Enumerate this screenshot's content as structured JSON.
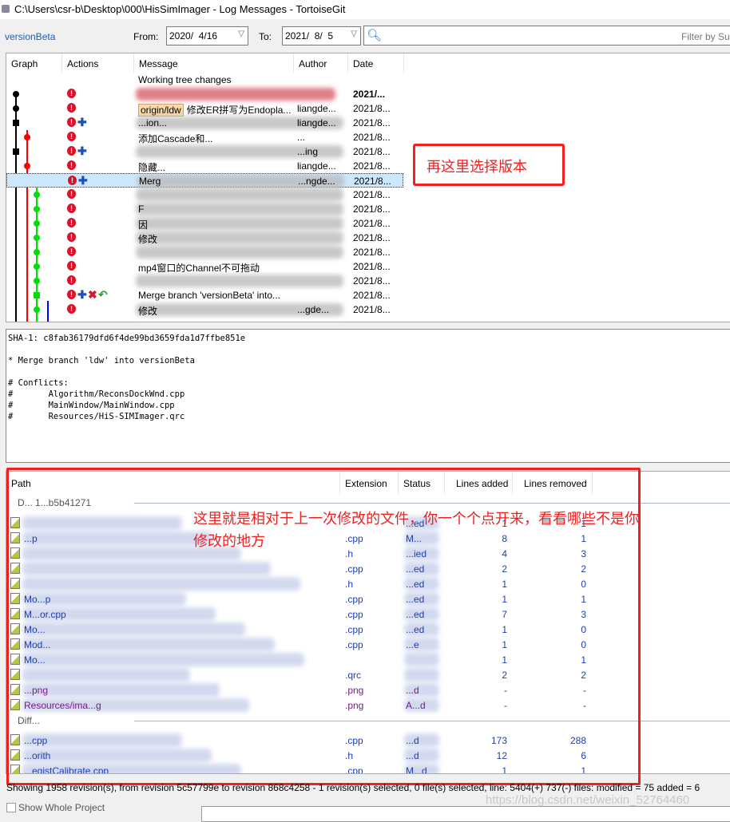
{
  "window": {
    "title": "C:\\Users\\csr-b\\Desktop\\000\\HisSimImager - Log Messages - TortoiseGit"
  },
  "toolbar": {
    "branch": "versionBeta",
    "from_label": "From:",
    "from_value": "2020/  4/16",
    "to_label": "To:",
    "to_value": "2021/  8/  5",
    "filter_placeholder": "Filter by Su"
  },
  "log": {
    "columns": [
      "Graph",
      "Actions",
      "Message",
      "Author",
      "Date"
    ],
    "rows": [
      {
        "message": "Working tree changes",
        "author": "",
        "date": "",
        "actions": []
      },
      {
        "message": "",
        "author": "",
        "date": "2021/...",
        "actions": [
          "conflict"
        ],
        "bold": true,
        "blur": "red"
      },
      {
        "badge": "origin/ldw",
        "message": "修改ER拼写为Endopla...",
        "author": "liangde...",
        "date": "2021/8...",
        "actions": [
          "conflict"
        ]
      },
      {
        "message": "...ion...",
        "author": "liangde...",
        "date": "2021/8...",
        "actions": [
          "conflict",
          "plus"
        ],
        "blur": "gray"
      },
      {
        "message": "添加Cascade和...",
        "author": "...",
        "date": "2021/8...",
        "actions": [
          "conflict"
        ]
      },
      {
        "message": "",
        "author": "...ing",
        "date": "2021/8...",
        "actions": [
          "conflict",
          "plus"
        ],
        "blur": "gray"
      },
      {
        "message": "隐藏...",
        "author": "liangde...",
        "date": "2021/8...",
        "actions": [
          "conflict"
        ]
      },
      {
        "message": "Merg",
        "author": "...ngde...",
        "date": "2021/8...",
        "actions": [
          "conflict",
          "plus"
        ],
        "selected": true,
        "blur": "gray"
      },
      {
        "message": "",
        "author": "",
        "date": "2021/8...",
        "actions": [
          "conflict"
        ],
        "blur": "gray"
      },
      {
        "message": "F",
        "author": "",
        "date": "2021/8...",
        "actions": [
          "conflict"
        ],
        "blur": "gray"
      },
      {
        "message": "因",
        "author": "",
        "date": "2021/8...",
        "actions": [
          "conflict"
        ],
        "blur": "gray"
      },
      {
        "message": "修改",
        "author": "",
        "date": "2021/8...",
        "actions": [
          "conflict"
        ],
        "blur": "gray"
      },
      {
        "message": "",
        "author": "",
        "date": "2021/8...",
        "actions": [
          "conflict"
        ],
        "blur": "gray"
      },
      {
        "message": "mp4窗口的Channel不可拖动",
        "author": "",
        "date": "2021/8...",
        "actions": [
          "conflict"
        ]
      },
      {
        "message": "",
        "author": "",
        "date": "2021/8...",
        "actions": [
          "conflict"
        ],
        "blur": "gray"
      },
      {
        "message": "Merge branch 'versionBeta' into...",
        "author": "",
        "date": "2021/8...",
        "actions": [
          "conflict",
          "plus",
          "delete",
          "revert"
        ]
      },
      {
        "message": "修改",
        "author": "...gde...",
        "date": "2021/8...",
        "actions": [
          "conflict"
        ],
        "blur": "gray"
      }
    ]
  },
  "annotation_top": "再这里选择版本",
  "commit_message": "SHA-1: c8fab36179dfd6f4de99bd3659fda1d7ffbe851e\n\n* Merge branch 'ldw' into versionBeta\n\n# Conflicts:\n#\tAlgorithm/ReconsDockWnd.cpp\n#\tMainWindow/MainWindow.cpp\n#\tResources/HiS-SIMImager.qrc",
  "files": {
    "columns": [
      "Path",
      "Extension",
      "Status",
      "Lines added",
      "Lines removed"
    ],
    "groups": [
      {
        "title": "D... 1...b5b41271",
        "rows": [
          {
            "path": "",
            "ext": "",
            "status": "...ed",
            "added": "1",
            "removed": "1"
          },
          {
            "path": "...p",
            "ext": ".cpp",
            "status": "M...",
            "added": "8",
            "removed": "1"
          },
          {
            "path": "",
            "ext": ".h",
            "status": "...ied",
            "added": "4",
            "removed": "3"
          },
          {
            "path": "",
            "ext": ".cpp",
            "status": "...ed",
            "added": "2",
            "removed": "2"
          },
          {
            "path": "",
            "ext": ".h",
            "status": "...ed",
            "added": "1",
            "removed": "0"
          },
          {
            "path": "Mo...p",
            "ext": ".cpp",
            "status": "...ed",
            "added": "1",
            "removed": "1"
          },
          {
            "path": "M...or.cpp",
            "ext": ".cpp",
            "status": "...ed",
            "added": "7",
            "removed": "3"
          },
          {
            "path": "Mo...",
            "ext": ".cpp",
            "status": "...ed",
            "added": "1",
            "removed": "0"
          },
          {
            "path": "Mod...",
            "ext": ".cpp",
            "status": "...e",
            "added": "1",
            "removed": "0"
          },
          {
            "path": "Mo...",
            "ext": "",
            "status": "",
            "added": "1",
            "removed": "1"
          },
          {
            "path": "",
            "ext": ".qrc",
            "status": "",
            "added": "2",
            "removed": "2"
          },
          {
            "path": "...png",
            "ext": ".png",
            "status": "...d",
            "added": "-",
            "removed": "-",
            "color": "#7a1a8a"
          },
          {
            "path": "Resources/ima...g",
            "ext": ".png",
            "status": "A...d",
            "added": "-",
            "removed": "-",
            "color": "#7a1a8a"
          }
        ]
      },
      {
        "title": "Diff...",
        "rows": [
          {
            "path": "...cpp",
            "ext": ".cpp",
            "status": "...d",
            "added": "173",
            "removed": "288"
          },
          {
            "path": "...orith",
            "ext": ".h",
            "status": "...d",
            "added": "12",
            "removed": "6"
          },
          {
            "path": "...egistCalibrate.cpp",
            "ext": ".cpp",
            "status": "M...d",
            "added": "1",
            "removed": "1"
          }
        ]
      }
    ]
  },
  "annotation_bottom": "这里就是相对于上一次修改的文件，你一个个点开来，看看哪些不是你修改的地方",
  "status_bar": "Showing 1958 revision(s), from revision 5c57799e to revision 868c4258 - 1 revision(s) selected, 0 file(s) selected, line: 5404(+) 737(-) files: modified = 75 added = 6",
  "watermark": "https://blog.csdn.net/weixin_52764460",
  "show_whole_project": "Show Whole Project",
  "colors": {
    "accent": "#1a5fb4",
    "annotation": "#f02020",
    "selection": "#cce8ff",
    "graph": [
      "#000000",
      "#ff0000",
      "#00e000",
      "#0000ff"
    ]
  }
}
